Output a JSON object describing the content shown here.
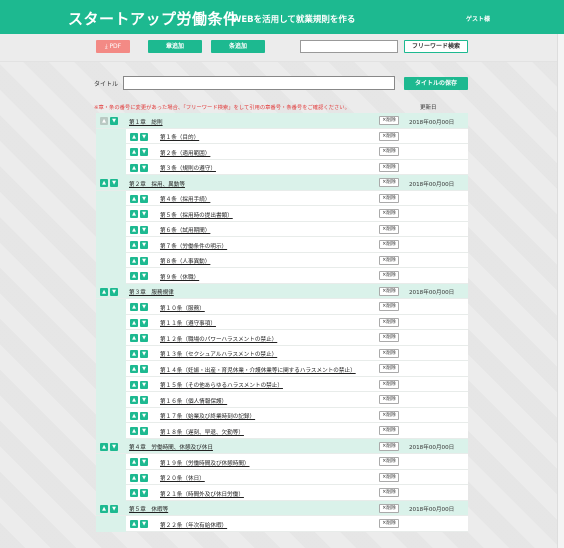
{
  "header": {
    "title": "スタートアップ労働条件",
    "subtitle": "WEBを活用して就業規則を作る",
    "user": "ゲスト様"
  },
  "toolbar": {
    "pdf_label": "PDF",
    "add_chapter_label": "章追加",
    "add_article_label": "条追加",
    "search_placeholder": "",
    "search_button_label": "フリーワード検索"
  },
  "title_area": {
    "label": "タイトル",
    "value": "",
    "save_label": "タイトルの保存"
  },
  "notice": "※章・条の番号に変更があった場合、「フリーワード検索」をして引用の章番号・条番号をご確認ください。",
  "updated_header": "更新日",
  "delete_label": "×削除",
  "chapters": [
    {
      "title": "第１章　総則",
      "date": "2018年00月00日",
      "articles": [
        "第１条（目的）",
        "第２条（適用範囲）",
        "第３条（規則の遵守）"
      ]
    },
    {
      "title": "第２章　採用、異動等",
      "date": "2018年00月00日",
      "articles": [
        "第４条（採用手続）",
        "第５条（採用時の提出書類）",
        "第６条（試用期間）",
        "第７条（労働条件の明示）",
        "第８条（人事異動）",
        "第９条（休職）"
      ]
    },
    {
      "title": "第３章　服務規律",
      "date": "2018年00月00日",
      "articles": [
        "第１０条（服務）",
        "第１１条（遵守事項）",
        "第１２条（職場のパワーハラスメントの禁止）",
        "第１３条（セクシュアルハラスメントの禁止）",
        "第１４条（妊娠・出産・育児休業・介護休業等に関するハラスメントの禁止）",
        "第１５条（その他あらゆるハラスメントの禁止）",
        "第１６条（個人情報保護）",
        "第１７条（始業及び終業時刻の記録）",
        "第１８条（遅刻、早退、欠勤等）"
      ]
    },
    {
      "title": "第４章　労働時間、休憩及び休日",
      "date": "2018年00月00日",
      "articles": [
        "第１９条（労働時間及び休憩時間）",
        "第２０条（休日）",
        "第２１条（時間外及び休日労働）"
      ]
    },
    {
      "title": "第５章　休暇等",
      "date": "2018年00月00日",
      "articles": [
        "第２２条（年次有給休暇）"
      ]
    }
  ],
  "colors": {
    "brand": "#1db990",
    "chapter_row": "#daf2ea",
    "pdf_button": "#f38a85",
    "notice": "#e23b3b"
  }
}
